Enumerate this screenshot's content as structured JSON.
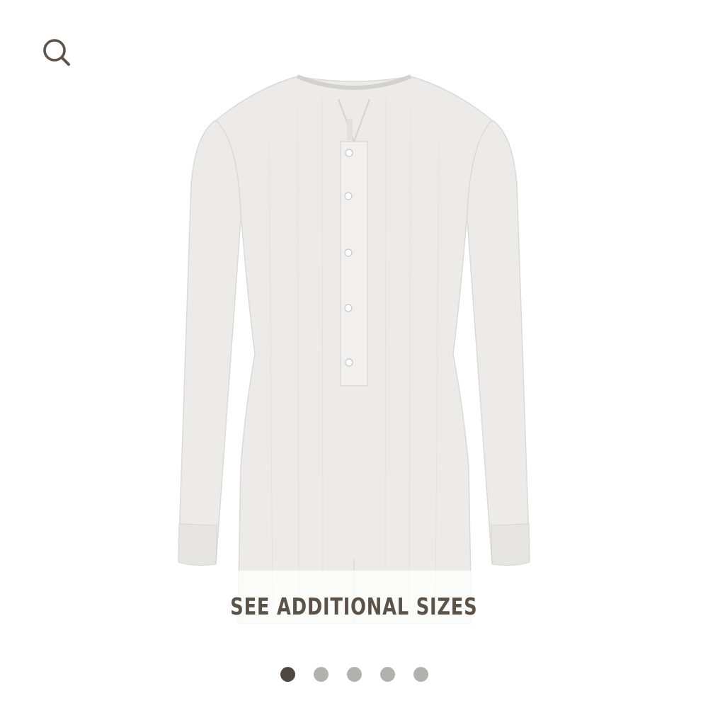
{
  "colors": {
    "text": "#5b5249",
    "dot_active": "#4e463f",
    "dot_inactive": "#b3b1b0",
    "garment": "#ecebe9",
    "garment_shade": "#d8d6d3"
  },
  "header": {
    "search_icon": "search-icon"
  },
  "product": {
    "image_icon": "bodysuit-image"
  },
  "sizes": {
    "label": "SEE ADDITIONAL SIZES"
  },
  "pager": {
    "count": 5,
    "active_index": 0
  }
}
